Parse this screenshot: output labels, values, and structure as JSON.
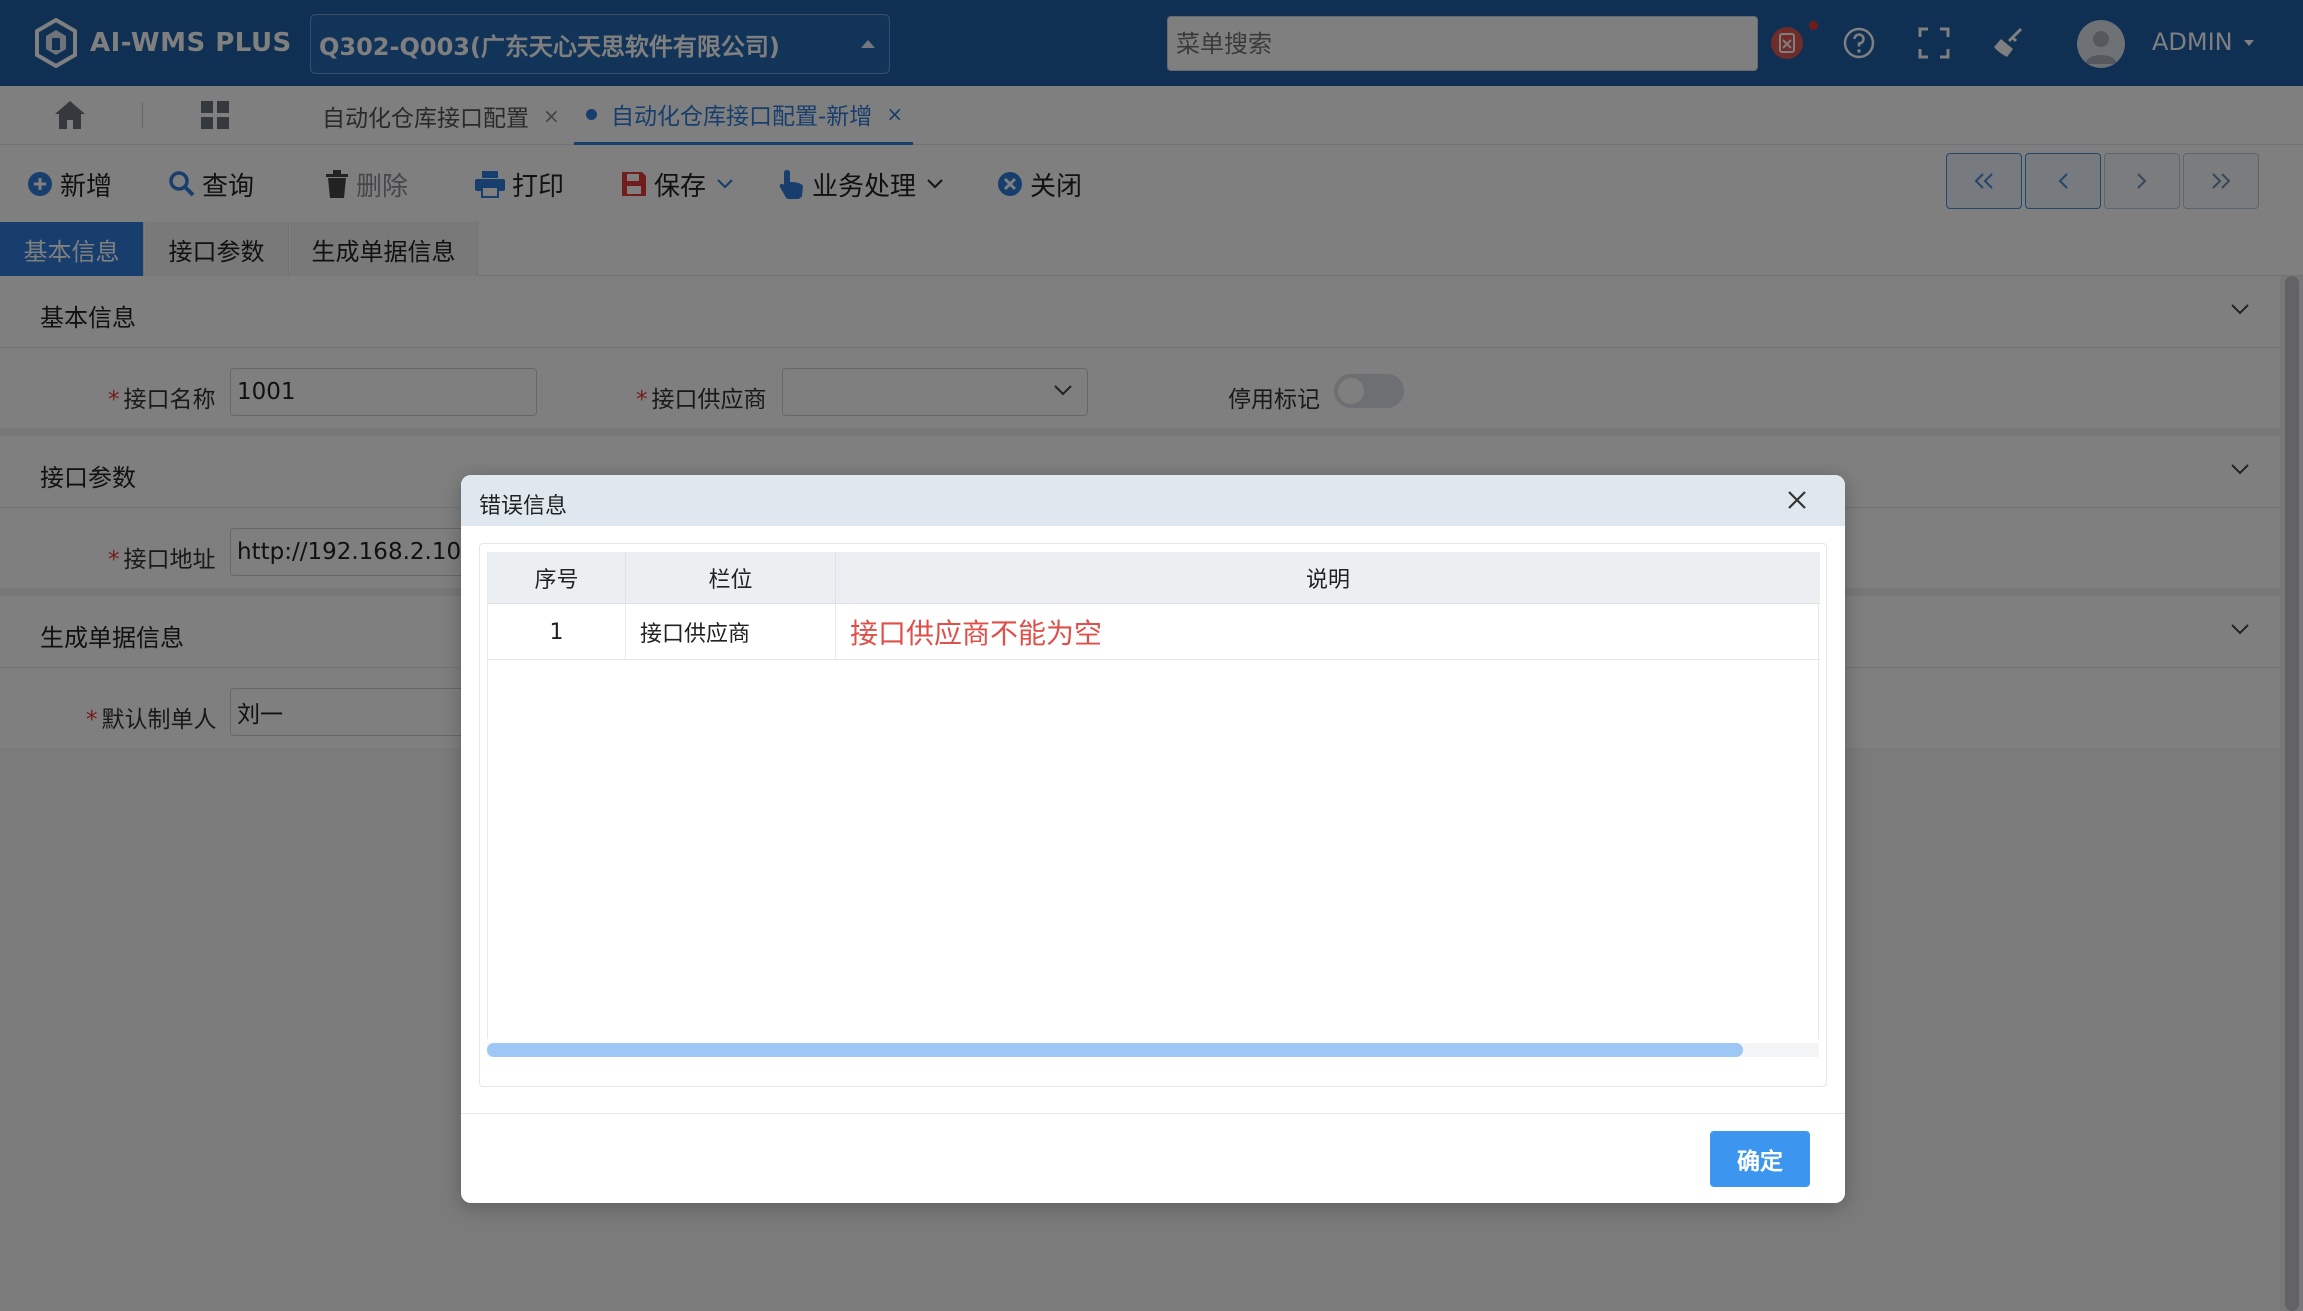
{
  "app": {
    "logo_text": "AI-WMS PLUS",
    "company": "Q302-Q003(广东天心天思软件有限公司)",
    "menu_search_placeholder": "菜单搜索",
    "user": "ADMIN"
  },
  "tabs": [
    {
      "label": "自动化仓库接口配置",
      "close": "×"
    },
    {
      "label": "自动化仓库接口配置-新增",
      "close": "×"
    }
  ],
  "toolbar": {
    "add": "新增",
    "query": "查询",
    "delete": "删除",
    "print": "打印",
    "save": "保存",
    "business": "业务处理",
    "close": "关闭"
  },
  "subtabs": [
    "基本信息",
    "接口参数",
    "生成单据信息"
  ],
  "sections": {
    "basic": {
      "title": "基本信息",
      "name_label": "接口名称",
      "name_value": "1001",
      "supplier_label": "接口供应商",
      "supplier_value": "",
      "disabled_label": "停用标记",
      "disabled": false
    },
    "params": {
      "title": "接口参数",
      "address_label": "接口地址",
      "address_value": "http://192.168.2.107/"
    },
    "docs": {
      "title": "生成单据信息",
      "maker_label": "默认制单人",
      "maker_value": "刘一"
    }
  },
  "dialog": {
    "title": "错误信息",
    "columns": [
      "序号",
      "栏位",
      "说明"
    ],
    "rows": [
      {
        "no": "1",
        "field": "接口供应商",
        "desc": "接口供应商不能为空"
      }
    ],
    "ok": "确定"
  },
  "colors": {
    "header": "#1f5fa6",
    "accent": "#2f7dd8",
    "error_text": "#e0504a",
    "ok_button": "#3c96f0"
  }
}
